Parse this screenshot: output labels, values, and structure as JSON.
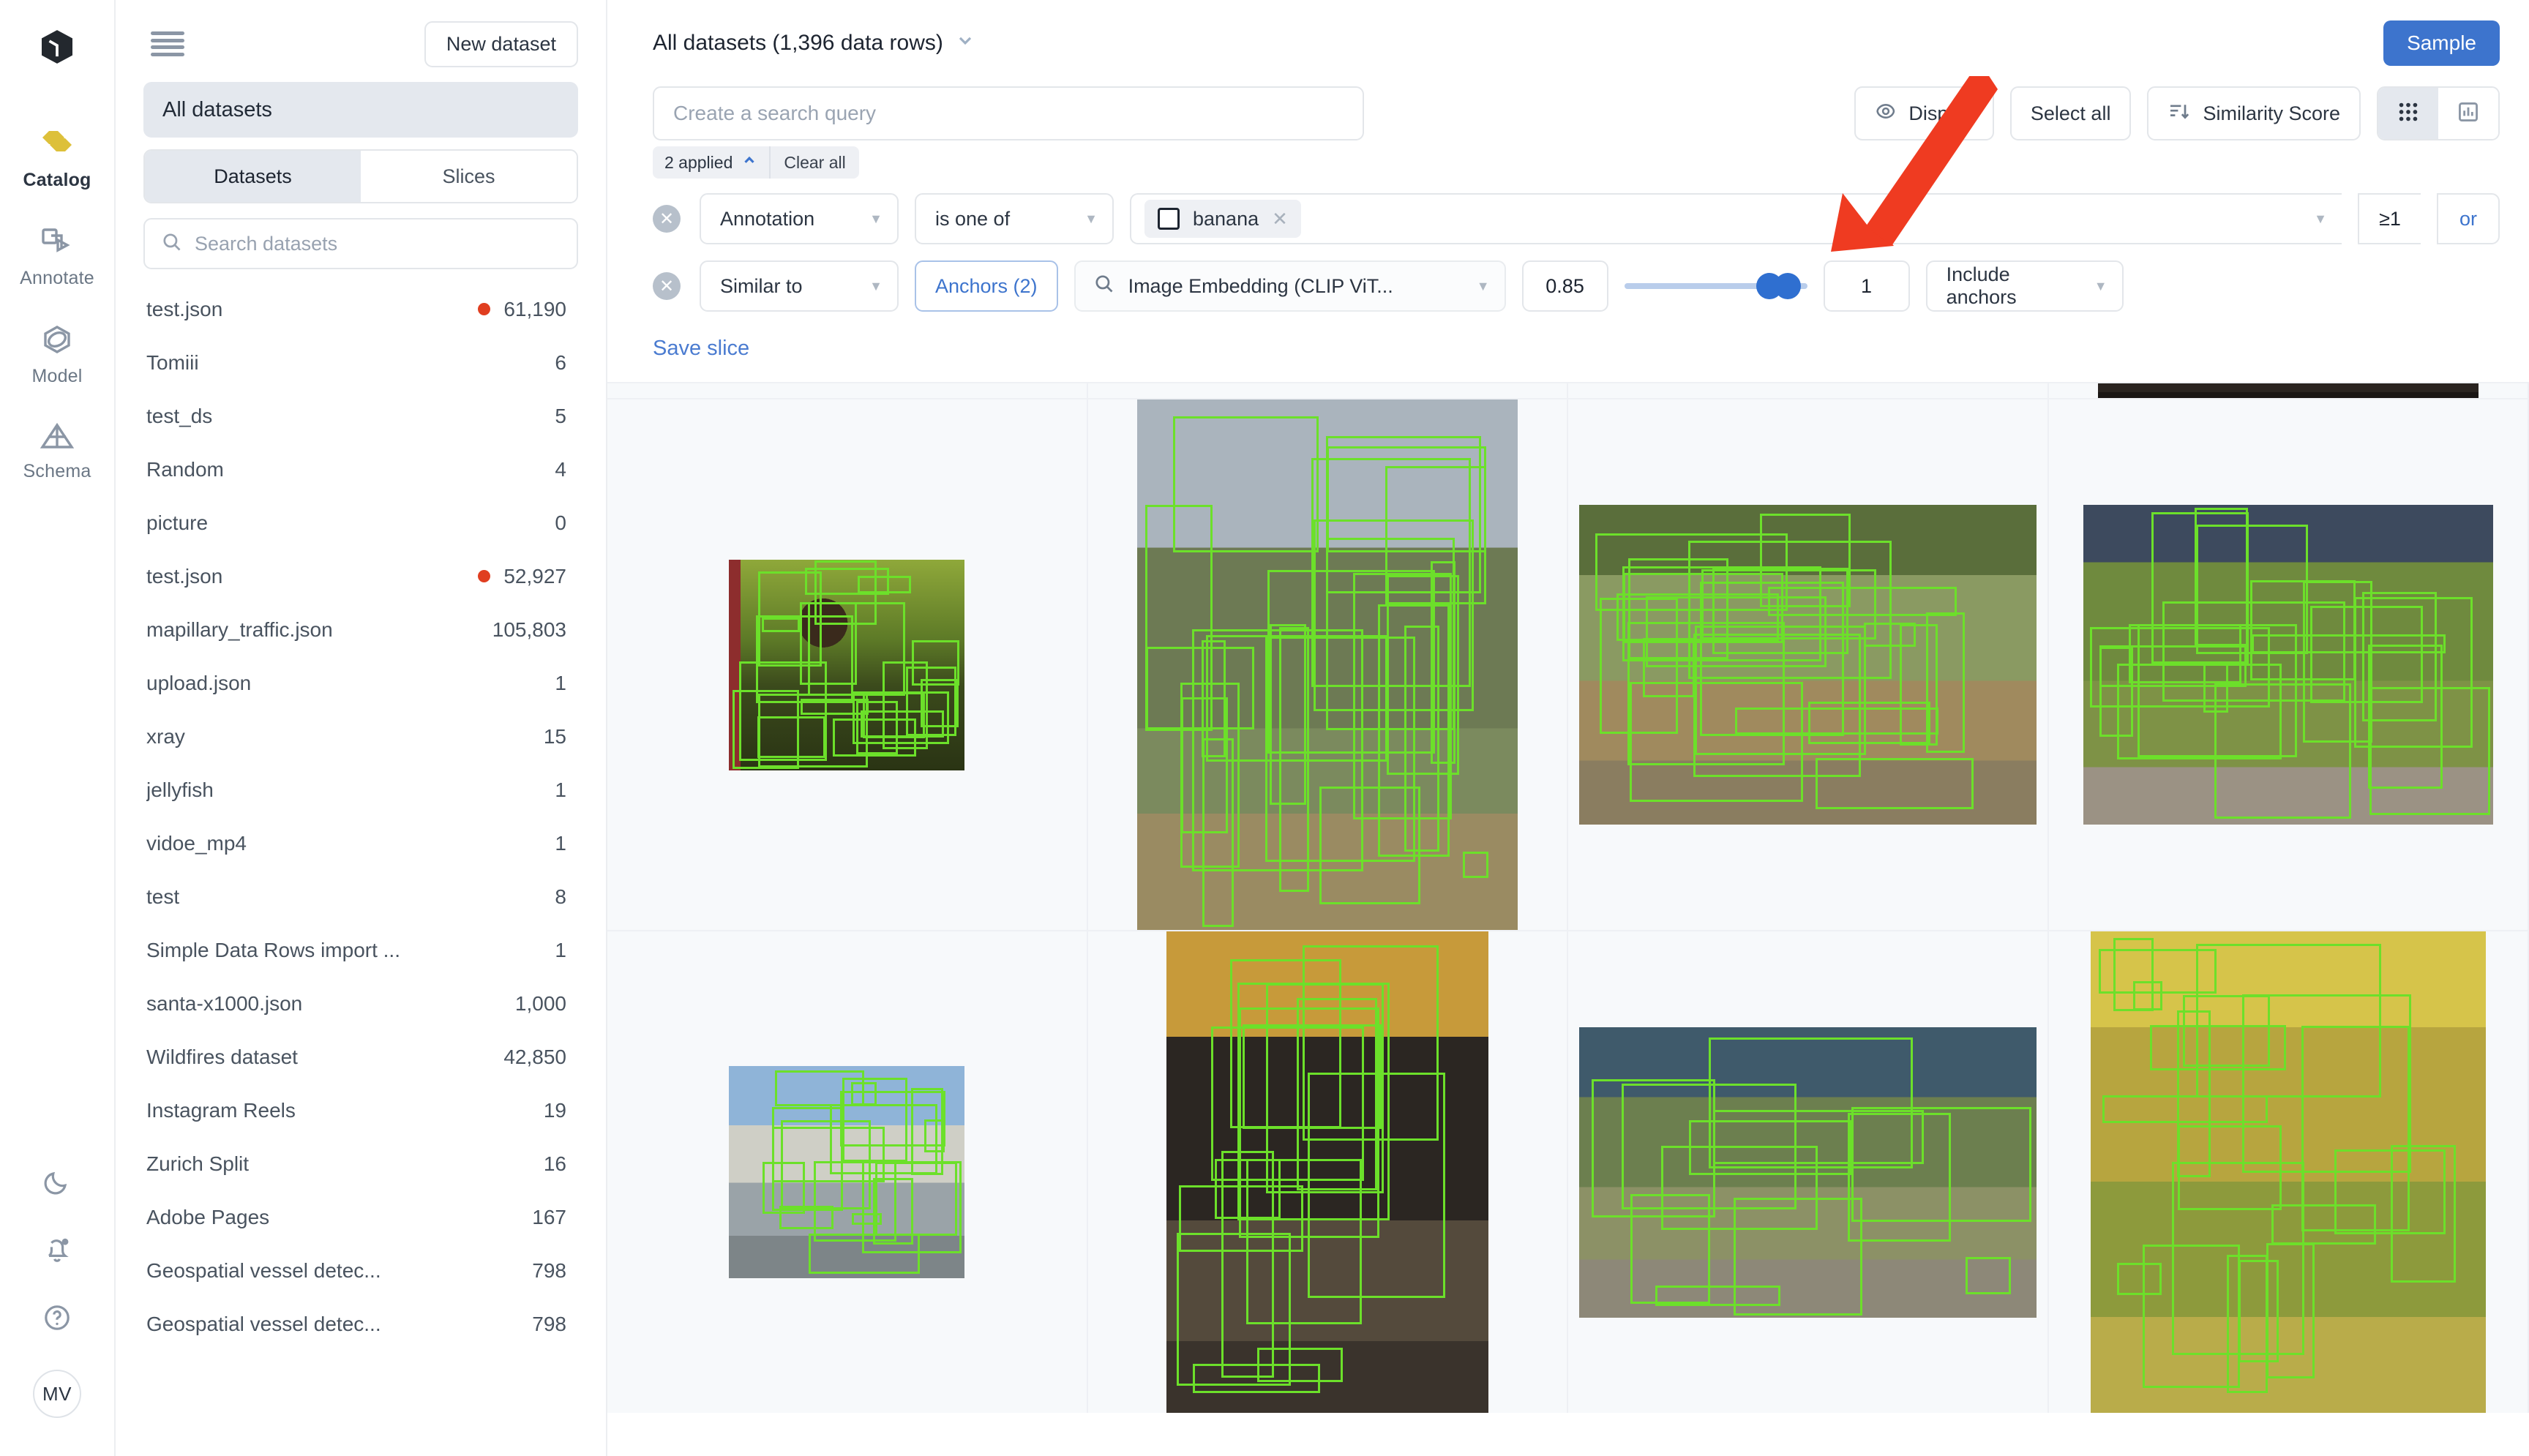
{
  "rail": {
    "logo_icon": "cube-logo-icon",
    "items": [
      {
        "label": "Catalog",
        "icon": "catalog-icon",
        "active": true
      },
      {
        "label": "Annotate",
        "icon": "annotate-icon",
        "active": false
      },
      {
        "label": "Model",
        "icon": "model-icon",
        "active": false
      },
      {
        "label": "Schema",
        "icon": "schema-icon",
        "active": false
      }
    ],
    "bottom": [
      {
        "icon": "moon-icon",
        "name": "dark-mode-toggle"
      },
      {
        "icon": "bell-icon",
        "name": "notifications-button"
      },
      {
        "icon": "help-circle-icon",
        "name": "help-button"
      }
    ],
    "avatar_initials": "MV"
  },
  "sidebar": {
    "menu_icon": "hamburger-menu-icon",
    "new_dataset_label": "New dataset",
    "all_datasets_label": "All datasets",
    "tabs": [
      {
        "label": "Datasets",
        "active": true
      },
      {
        "label": "Slices",
        "active": false
      }
    ],
    "search_placeholder": "Search datasets",
    "search_value": "",
    "search_icon": "search-icon",
    "datasets": [
      {
        "name": "test.json",
        "count": "61,190",
        "dot": true
      },
      {
        "name": "Tomiii",
        "count": "6",
        "dot": false
      },
      {
        "name": "test_ds",
        "count": "5",
        "dot": false
      },
      {
        "name": "Random",
        "count": "4",
        "dot": false
      },
      {
        "name": "picture",
        "count": "0",
        "dot": false
      },
      {
        "name": "test.json",
        "count": "52,927",
        "dot": true
      },
      {
        "name": "mapillary_traffic.json",
        "count": "105,803",
        "dot": false
      },
      {
        "name": "upload.json",
        "count": "1",
        "dot": false
      },
      {
        "name": "xray",
        "count": "15",
        "dot": false
      },
      {
        "name": "jellyfish",
        "count": "1",
        "dot": false
      },
      {
        "name": "vidoe_mp4",
        "count": "1",
        "dot": false
      },
      {
        "name": "test",
        "count": "8",
        "dot": false
      },
      {
        "name": "Simple Data Rows import ...",
        "count": "1",
        "dot": false
      },
      {
        "name": "santa-x1000.json",
        "count": "1,000",
        "dot": false
      },
      {
        "name": "Wildfires dataset",
        "count": "42,850",
        "dot": false
      },
      {
        "name": "Instagram Reels",
        "count": "19",
        "dot": false
      },
      {
        "name": "Zurich Split",
        "count": "16",
        "dot": false
      },
      {
        "name": "Adobe Pages",
        "count": "167",
        "dot": false
      },
      {
        "name": "Geospatial vessel detec...",
        "count": "798",
        "dot": false
      },
      {
        "name": "Geospatial vessel detec...",
        "count": "798",
        "dot": false
      }
    ]
  },
  "header": {
    "breadcrumb": "All datasets (1,396 data rows)",
    "breadcrumb_caret_icon": "chevron-down-icon",
    "sample_label": "Sample"
  },
  "search": {
    "placeholder": "Create a search query",
    "value": ""
  },
  "toolbar": {
    "display_label": "Display",
    "display_icon": "eye-icon",
    "select_all_label": "Select all",
    "sort_label": "Similarity Score",
    "sort_icon": "sort-descending-icon",
    "grid_view_icon": "grid-view-icon",
    "chart_view_icon": "bar-chart-view-icon",
    "grid_view_active": true
  },
  "applied": {
    "count_label": "2 applied",
    "collapse_icon": "chevron-up-icon",
    "clear_all_label": "Clear all"
  },
  "filters": [
    {
      "remove_icon": "remove-filter-icon",
      "field": "Annotation",
      "operator": "is one of",
      "chip": {
        "label": "banana",
        "checkbox_checked": false,
        "remove_icon": "chip-remove-icon"
      },
      "count": "≥1",
      "conjunction": "or"
    },
    {
      "remove_icon": "remove-filter-icon",
      "field": "Similar to",
      "anchors_label": "Anchors (2)",
      "embedding_icon": "search-icon",
      "embedding": "Image Embedding (CLIP ViT...",
      "threshold": "0.85",
      "slider_position_pct": 78,
      "top_k": "1",
      "anchors_mode": "Include anchors"
    }
  ],
  "save_slice_label": "Save slice",
  "accent_colors": {
    "primary_blue": "#3d74cd",
    "link_blue": "#4a7bd0",
    "bbox_green": "#6ce02a",
    "badge_red": "#e03e20",
    "arrow_red": "#ef3b21",
    "catalog_yellow": "#ddc03a"
  },
  "grid": {
    "columns": 4,
    "cells": [
      {
        "name": "partial-thumb-top-1",
        "scene": "",
        "partial": true,
        "boxes": []
      },
      {
        "name": "partial-thumb-top-2",
        "scene": "",
        "partial": true,
        "boxes": []
      },
      {
        "name": "partial-thumb-top-3",
        "scene": "",
        "partial": true,
        "boxes": []
      },
      {
        "name": "partial-thumb-top-4",
        "scene": "s9",
        "partial": true,
        "boxes": []
      },
      {
        "name": "thumb-man-with-bananas",
        "scene": "s1",
        "partial": false,
        "boxes": 22
      },
      {
        "name": "thumb-banana-cart-baskets",
        "scene": "s2",
        "partial": false,
        "boxes": 26
      },
      {
        "name": "thumb-street-market-vendors",
        "scene": "s3",
        "partial": false,
        "boxes": 24
      },
      {
        "name": "thumb-roadside-banana-pile",
        "scene": "s4",
        "partial": false,
        "boxes": 20
      },
      {
        "name": "thumb-woman-carrying-basin",
        "scene": "s5",
        "partial": false,
        "boxes": 18
      },
      {
        "name": "thumb-shopkeeper-banana-stall",
        "scene": "s6",
        "partial": false,
        "boxes": 16
      },
      {
        "name": "thumb-vegetable-seller",
        "scene": "s7",
        "partial": false,
        "boxes": 12
      },
      {
        "name": "thumb-banana-bunch-vendor",
        "scene": "s8",
        "partial": false,
        "boxes": 20
      }
    ]
  }
}
